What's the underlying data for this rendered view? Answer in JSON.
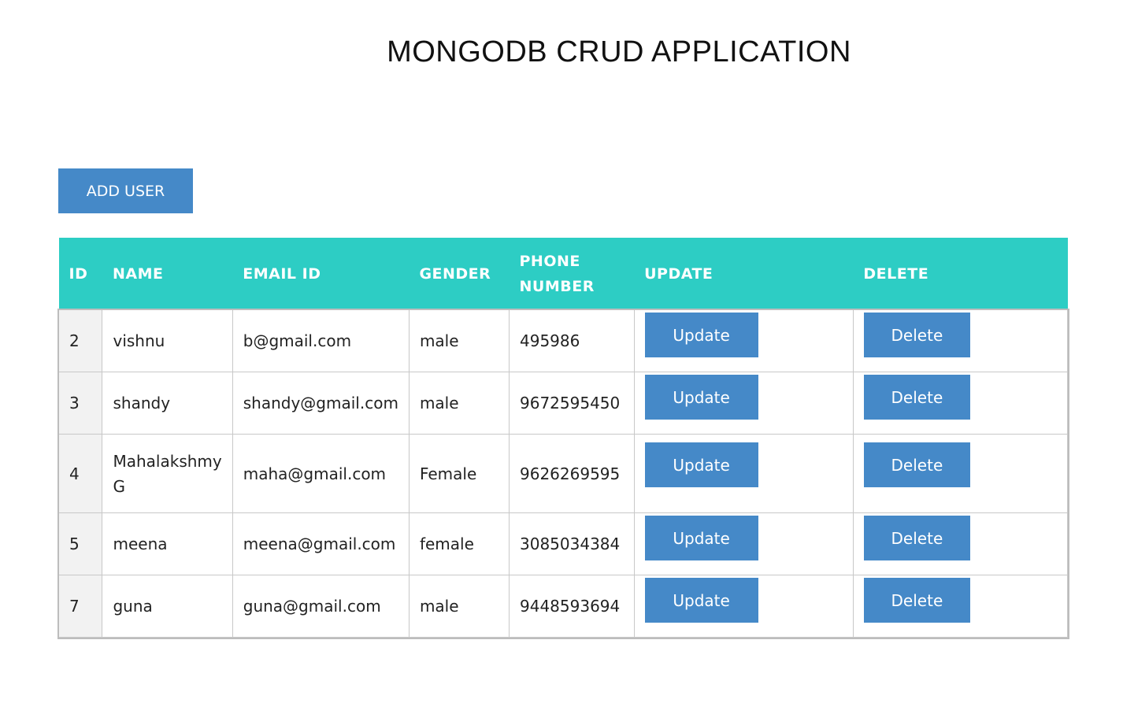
{
  "header": {
    "title": "MONGODB CRUD APPLICATION"
  },
  "toolbar": {
    "add_user_label": "ADD USER"
  },
  "table": {
    "columns": [
      "ID",
      "NAME",
      "EMAIL ID",
      "GENDER",
      "PHONE NUMBER",
      "UPDATE",
      "DELETE"
    ],
    "update_label": "Update",
    "delete_label": "Delete",
    "rows": [
      {
        "id": "2",
        "name": "vishnu",
        "email": "b@gmail.com",
        "gender": "male",
        "phone": "495986"
      },
      {
        "id": "3",
        "name": "shandy",
        "email": "shandy@gmail.com",
        "gender": "male",
        "phone": "9672595450"
      },
      {
        "id": "4",
        "name": "Mahalakshmy G",
        "email": "maha@gmail.com",
        "gender": "Female",
        "phone": "9626269595"
      },
      {
        "id": "5",
        "name": "meena",
        "email": "meena@gmail.com",
        "gender": "female",
        "phone": "3085034384"
      },
      {
        "id": "7",
        "name": "guna",
        "email": "guna@gmail.com",
        "gender": "male",
        "phone": "9448593694"
      }
    ]
  },
  "colors": {
    "header_bg": "#2dcdc4",
    "button_bg": "#4589c8",
    "id_cell_bg": "#f2f2f2",
    "border": "#c8c8c8"
  }
}
